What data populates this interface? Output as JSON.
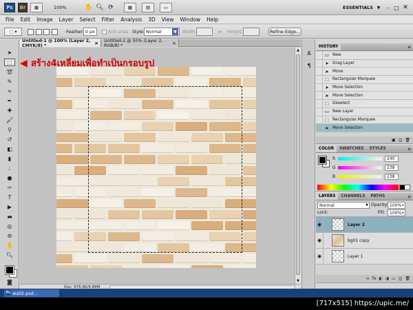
{
  "appbar": {
    "logo": "Ps",
    "bridge": "Br",
    "zoom": "100%",
    "workspace": "ESSENTIALS"
  },
  "menu": [
    "File",
    "Edit",
    "Image",
    "Layer",
    "Select",
    "Filter",
    "Analysis",
    "3D",
    "View",
    "Window",
    "Help"
  ],
  "options": {
    "feather_label": "Feather:",
    "feather_value": "0 px",
    "antialias_label": "Anti-alias",
    "style_label": "Style:",
    "style_value": "Normal",
    "width_label": "Width:",
    "height_label": "Height:",
    "refine_label": "Refine Edge..."
  },
  "documents": {
    "tab1": "Untitled-1 @ 100% (Layer 2, CMYK/8) *",
    "tab2": "Untitled-2 @ 50% (Layer 2, RGB/8) *",
    "status": "Doc: 976.6K/4.89M"
  },
  "annotation": {
    "text": "สร้าง4เหลี่ยมเพื่อทำเป็นกรอบรูป"
  },
  "history": {
    "tab": "HISTORY",
    "items": [
      {
        "label": "New",
        "icon": "doc-icon"
      },
      {
        "label": "Drag Layer",
        "icon": "move-icon"
      },
      {
        "label": "Move",
        "icon": "move-icon"
      },
      {
        "label": "Rectangular Marquee",
        "icon": "marquee-icon"
      },
      {
        "label": "Move Selection",
        "icon": "move-icon"
      },
      {
        "label": "Move Selection",
        "icon": "move-icon"
      },
      {
        "label": "Deselect",
        "icon": "marquee-icon"
      },
      {
        "label": "New Layer",
        "icon": "doc-icon"
      },
      {
        "label": "Rectangular Marquee",
        "icon": "marquee-icon"
      },
      {
        "label": "Move Selection",
        "icon": "move-icon",
        "selected": true
      }
    ]
  },
  "color": {
    "tabs": [
      "COLOR",
      "SWATCHES",
      "STYLES"
    ],
    "r_label": "R",
    "r_value": "240",
    "g_label": "G",
    "g_value": "238",
    "b_label": "B",
    "b_value": "238"
  },
  "layers": {
    "tabs": [
      "LAYERS",
      "CHANNELS",
      "PATHS"
    ],
    "blend_mode": "Normal",
    "opacity_label": "Opacity:",
    "opacity_value": "100%",
    "lock_label": "Lock:",
    "fill_label": "Fill:",
    "fill_value": "100%",
    "items": [
      {
        "name": "Layer 2",
        "selected": true
      },
      {
        "name": "bg01 copy",
        "selected": false
      },
      {
        "name": "Layer 1",
        "selected": false
      }
    ]
  },
  "taskbar": {
    "item": "wall2.psd..."
  },
  "footer": "[717x515] https://upic.me/"
}
